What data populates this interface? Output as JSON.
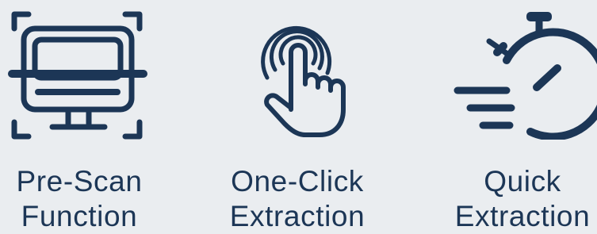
{
  "features": [
    {
      "icon": "monitor-scan-icon",
      "label_line1": "Pre-Scan",
      "label_line2": "Function"
    },
    {
      "icon": "finger-tap-icon",
      "label_line1": "One-Click",
      "label_line2": "Extraction"
    },
    {
      "icon": "fast-stopwatch-icon",
      "label_line1": "Quick",
      "label_line2": "Extraction"
    }
  ],
  "colors": {
    "background": "#eaedf0",
    "primary": "#1c3656"
  }
}
